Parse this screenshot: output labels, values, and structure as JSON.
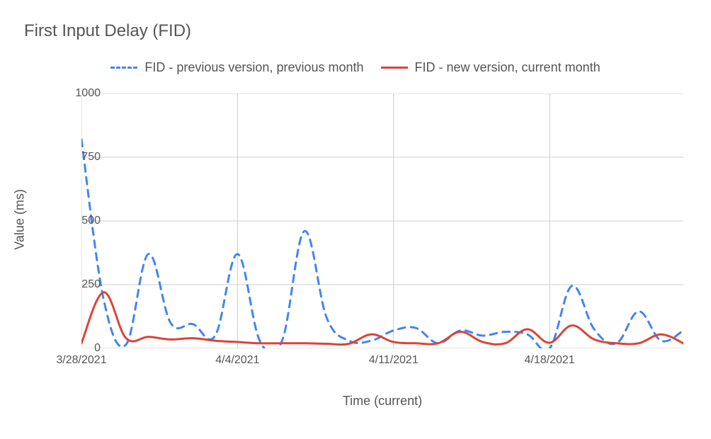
{
  "title": "First Input Delay (FID)",
  "xlabel": "Time (current)",
  "ylabel": "Value (ms)",
  "legend": {
    "prev": "FID - previous version, previous month",
    "curr": "FID - new version, current month"
  },
  "y_ticks": [
    "0",
    "250",
    "500",
    "750",
    "1000"
  ],
  "x_tick_labels": [
    "3/28/2021",
    "4/4/2021",
    "4/11/2021",
    "4/18/2021"
  ],
  "x_tick_positions": [
    0,
    7,
    14,
    21
  ],
  "chart_data": {
    "type": "line",
    "xlabel": "Time (current)",
    "ylabel": "Value (ms)",
    "title": "First Input Delay (FID)",
    "ylim": [
      0,
      1000
    ],
    "x": [
      "3/28/2021",
      "3/29/2021",
      "3/30/2021",
      "3/31/2021",
      "4/1/2021",
      "4/2/2021",
      "4/3/2021",
      "4/4/2021",
      "4/5/2021",
      "4/6/2021",
      "4/7/2021",
      "4/8/2021",
      "4/9/2021",
      "4/10/2021",
      "4/11/2021",
      "4/12/2021",
      "4/13/2021",
      "4/14/2021",
      "4/15/2021",
      "4/16/2021",
      "4/17/2021",
      "4/18/2021",
      "4/19/2021",
      "4/20/2021",
      "4/21/2021",
      "4/22/2021",
      "4/23/2021",
      "4/24/2021"
    ],
    "series": [
      {
        "name": "FID - previous version, previous month",
        "style": "dashed",
        "color": "#4285f4",
        "values": [
          820,
          190,
          15,
          370,
          100,
          95,
          50,
          370,
          30,
          30,
          460,
          120,
          30,
          30,
          70,
          80,
          20,
          70,
          50,
          65,
          55,
          0,
          245,
          75,
          20,
          145,
          30,
          70
        ]
      },
      {
        "name": "FID - new version, current month",
        "style": "solid",
        "color": "#db4437",
        "values": [
          20,
          220,
          40,
          45,
          35,
          40,
          30,
          25,
          20,
          20,
          20,
          18,
          18,
          55,
          25,
          20,
          20,
          65,
          25,
          20,
          75,
          22,
          90,
          35,
          20,
          20,
          55,
          20
        ]
      }
    ]
  }
}
